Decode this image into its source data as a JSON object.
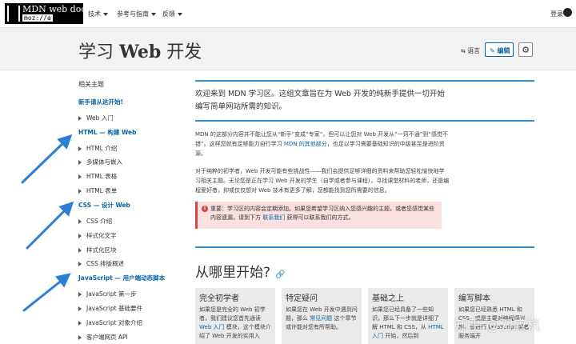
{
  "header": {
    "logo_line1": "MDN web docs",
    "logo_line2": "moz://a",
    "nav": [
      "技术",
      "参考与指南",
      "反馈"
    ],
    "login": "登录"
  },
  "title_band": {
    "title_cjk_1": "学习 ",
    "title_latin": "Web",
    "title_cjk_2": " 开发",
    "language": "语言",
    "edit": "编辑",
    "gear_icon": "gear-icon"
  },
  "sidebar": {
    "heading": "相关主题",
    "intro_link": "新手请从这开始!",
    "items_a": [
      "Web 入门"
    ],
    "section_html": "HTML — 构建 Web",
    "items_html": [
      "HTML 介绍",
      "多媒体与嵌入",
      "HTML 表格",
      "HTML 表单"
    ],
    "section_css": "CSS — 设计 Web",
    "items_css": [
      "CSS 介绍",
      "样式化文字",
      "样式化区块",
      "CSS 排版概述"
    ],
    "section_js": "JavaScript — 用户端动态脚本",
    "items_js": [
      "JavaScript 第一步",
      "JavaScript 基础要件",
      "JavaScript 对象介绍",
      "客户端网页 API"
    ]
  },
  "main": {
    "lead": "欢迎来到 MDN 学习区。这组文章旨在为 Web 开发的纯新手提供一切开始编写简单网站所需的知识。",
    "para1_a": "MDN 的这部分内容并不能让您从“新手”变成“专家”，但可以让您对 Web 开发从“一窍不通”到“感觉不错”。这样您就有足够能力自行学习 ",
    "para1_link": "MDN 的其他部分",
    "para1_b": "，也足以学习需要基础知识的中级甚至是进阶资源。",
    "para2": "对于纯粹的初学者，Web 开发可能有些挑战性——我们会提供足够详细的资料来帮助您轻松愉快地学习相关主题。无论您是正在学习 Web 开发的学生（自学或者参与课程），寻找课堂材料的老师，还是编程爱好者，抑或仅仅想对 Web 技术有更多了解，您都能找到您所需要的信息。",
    "note_a": "重要：学习区的内容会定期添加。如果您希望学习区纳入您感兴趣的主题，或者您感觉某些内容遗漏，请到下方 ",
    "note_link": "联系我们",
    "note_b": " 获得可以联系我们的方式。",
    "note_icon": "alert-icon",
    "h2": "从哪里开始?",
    "h2_icon": "link-icon"
  },
  "cards": [
    {
      "title": "完全初学者",
      "body_a": "如果您是完全的 Web 初学者，我们建议您首先通读 ",
      "link": "Web 入门",
      "body_b": " 模块，这个模块介绍了 Web 开发的实用入"
    },
    {
      "title": "特定疑问",
      "body_a": "如果您在 Web 开发中遇到问题，那么 ",
      "link": "常见问题",
      "body_b": " 这个章节或许能对您有所帮助。"
    },
    {
      "title": "基础之上",
      "body_a": "如果您已经具备了一些知识，那么下一步就是详细了解 HTML 和 CSS，从 ",
      "link": "HTML 入门",
      "body_b": " 开始，然后到"
    },
    {
      "title": "编写脚本",
      "body_a": "如果您已经熟悉 HTML 和 CSS，或是主要对编程感兴趣，想进行 JavaScript 或者服务端开",
      "link": "",
      "body_b": ""
    }
  ],
  "watermark": "知乎 @刀应杭",
  "colors": {
    "link": "#0a64a4",
    "accent_rule": "#3a8ecc",
    "arrow": "#2b7fd4",
    "note_bg": "#fbe0df",
    "note_border": "#d04848"
  }
}
